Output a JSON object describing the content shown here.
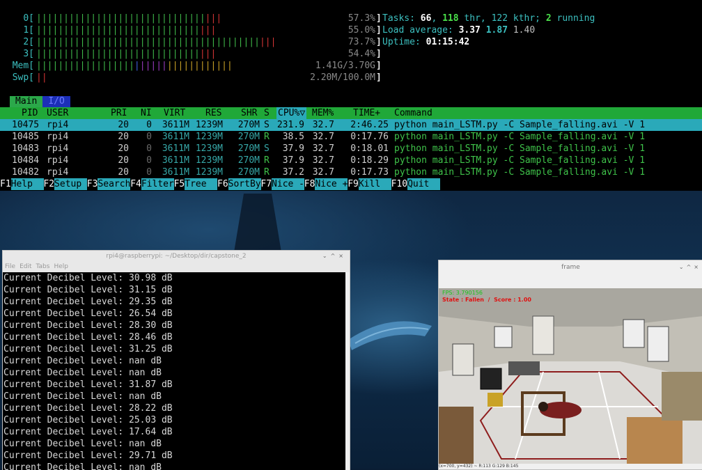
{
  "htop": {
    "cpu_meters": [
      {
        "label": "0[",
        "pct": "57.3%"
      },
      {
        "label": "1[",
        "pct": "55.0%"
      },
      {
        "label": "2[",
        "pct": "73.7%"
      },
      {
        "label": "3[",
        "pct": "54.4%"
      }
    ],
    "mem": {
      "label": "Mem[",
      "value": "1.41G/3.70G"
    },
    "swp": {
      "label": "Swp[",
      "value": "2.20M/100.0M"
    },
    "tasks": {
      "prefix": "Tasks: ",
      "tasks": "66",
      "sep1": ", ",
      "thr": "118",
      "thr_label": " thr, ",
      "kthr": "122 kthr; ",
      "running": "2",
      "running_label": " running"
    },
    "load": {
      "prefix": "Load average: ",
      "l1": "3.37",
      "l5": "1.87",
      "l15": "1.40"
    },
    "uptime": {
      "prefix": "Uptime: ",
      "value": "01:15:42"
    },
    "tabs": [
      "Main",
      "I/O"
    ],
    "columns": {
      "pid": "PID",
      "user": "USER",
      "pri": "PRI",
      "ni": "NI",
      "virt": "VIRT",
      "res": "RES",
      "shr": "SHR",
      "s": "S",
      "cpu": "CPU%",
      "sort": "▽",
      "mem": "MEM%",
      "time": "TIME+",
      "cmd": "Command"
    },
    "processes": [
      {
        "pid": "10475",
        "user": "rpi4",
        "pri": "20",
        "ni": "0",
        "virt": "3611M",
        "res": "1239M",
        "shr": "270M",
        "s": "S",
        "cpu": "231.9",
        "mem": "32.7",
        "time": "2:46.25",
        "cmd": "python main_LSTM.py -C Sample_falling.avi -V 1"
      },
      {
        "pid": "10485",
        "user": "rpi4",
        "pri": "20",
        "ni": "0",
        "virt": "3611M",
        "res": "1239M",
        "shr": "270M",
        "s": "R",
        "cpu": "38.5",
        "mem": "32.7",
        "time": "0:17.76",
        "cmd": "python main_LSTM.py -C Sample_falling.avi -V 1"
      },
      {
        "pid": "10483",
        "user": "rpi4",
        "pri": "20",
        "ni": "0",
        "virt": "3611M",
        "res": "1239M",
        "shr": "270M",
        "s": "S",
        "cpu": "37.9",
        "mem": "32.7",
        "time": "0:18.01",
        "cmd": "python main_LSTM.py -C Sample_falling.avi -V 1"
      },
      {
        "pid": "10484",
        "user": "rpi4",
        "pri": "20",
        "ni": "0",
        "virt": "3611M",
        "res": "1239M",
        "shr": "270M",
        "s": "R",
        "cpu": "37.9",
        "mem": "32.7",
        "time": "0:18.29",
        "cmd": "python main_LSTM.py -C Sample_falling.avi -V 1"
      },
      {
        "pid": "10482",
        "user": "rpi4",
        "pri": "20",
        "ni": "0",
        "virt": "3611M",
        "res": "1239M",
        "shr": "270M",
        "s": "R",
        "cpu": "37.2",
        "mem": "32.7",
        "time": "0:17.73",
        "cmd": "python main_LSTM.py -C Sample_falling.avi -V 1"
      }
    ],
    "fkeys": [
      {
        "key": "F1",
        "label": "Help  "
      },
      {
        "key": "F2",
        "label": "Setup "
      },
      {
        "key": "F3",
        "label": "Search"
      },
      {
        "key": "F4",
        "label": "Filter"
      },
      {
        "key": "F5",
        "label": "Tree  "
      },
      {
        "key": "F6",
        "label": "SortBy"
      },
      {
        "key": "F7",
        "label": "Nice -"
      },
      {
        "key": "F8",
        "label": "Nice +"
      },
      {
        "key": "F9",
        "label": "Kill  "
      },
      {
        "key": "F10",
        "label": "Quit  "
      }
    ]
  },
  "terminal": {
    "title": "rpi4@raspberrypi: ~/Desktop/dir/capstone_2",
    "menu": [
      "File",
      "Edit",
      "Tabs",
      "Help"
    ],
    "lines": [
      "Current Decibel Level: 30.98 dB",
      "Current Decibel Level: 31.15 dB",
      "Current Decibel Level: 29.35 dB",
      "Current Decibel Level: 26.54 dB",
      "Current Decibel Level: 28.30 dB",
      "Current Decibel Level: 28.46 dB",
      "Current Decibel Level: 31.25 dB",
      "Current Decibel Level: nan dB",
      "Current Decibel Level: nan dB",
      "Current Decibel Level: 31.87 dB",
      "Current Decibel Level: nan dB",
      "Current Decibel Level: 28.22 dB",
      "Current Decibel Level: 25.03 dB",
      "Current Decibel Level: 17.64 dB",
      "Current Decibel Level: nan dB",
      "Current Decibel Level: 29.71 dB",
      "Current Decibel Level: nan dB"
    ]
  },
  "frame": {
    "title": "frame",
    "fps": "FPS: 3.790156",
    "state": "State : Fallen  /  Score : 1.00",
    "status": "(x=700, y=432) ~ R:113 G:129 B:145"
  },
  "colors": {
    "green": "#2ba84a",
    "cyan": "#2aa9b9",
    "selected": "#2aa9b9"
  }
}
